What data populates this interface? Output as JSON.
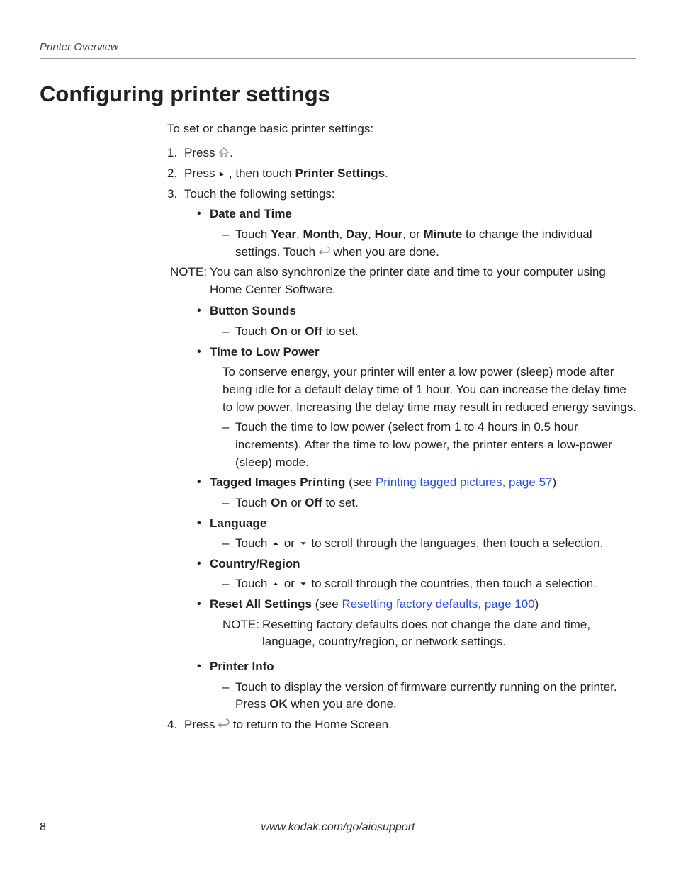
{
  "running_header": "Printer Overview",
  "section_title": "Configuring printer settings",
  "intro": "To set or change basic printer settings:",
  "step1_a": "Press ",
  "step1_b": ".",
  "step2_a": "Press ",
  "step2_b": " , then touch ",
  "step2_bold": "Printer Settings",
  "step2_c": ".",
  "step3": "Touch the following settings:",
  "date_time_label": "Date and Time",
  "date_time_sub_a": "Touch ",
  "date_time_year": "Year",
  "date_time_comma": ", ",
  "date_time_month": "Month",
  "date_time_day": "Day",
  "date_time_hour": "Hour",
  "date_time_or": ", or ",
  "date_time_minute": "Minute",
  "date_time_sub_b": " to change the individual settings. Touch ",
  "date_time_sub_c": " when you are done.",
  "note1_label": "NOTE:",
  "note1_text": "You can also synchronize the printer date and time to your computer using Home Center Software.",
  "button_sounds_label": "Button Sounds",
  "on_off_a": "Touch ",
  "on": "On",
  "or_word": " or ",
  "off": "Off",
  "on_off_b": " to set.",
  "time_low_power_label": "Time to Low Power",
  "time_low_power_para": "To conserve energy, your printer will enter a low power (sleep) mode after being idle for a default delay time of 1 hour. You can increase the delay time to low power. Increasing the delay time may result in reduced energy savings.",
  "time_low_power_sub": "Touch the time to low power (select from 1 to 4 hours in 0.5 hour increments). After the time to low power, the printer enters a low-power (sleep) mode.",
  "tagged_label": "Tagged Images Printing",
  "tagged_see_a": " (see ",
  "tagged_link": "Printing tagged pictures, page 57",
  "tagged_see_b": ")",
  "language_label": "Language",
  "lang_sub_a": "Touch ",
  "lang_sub_b": " or ",
  "lang_sub_c": " to scroll through the languages, then touch a selection.",
  "country_label": "Country/Region",
  "country_sub_c": " to scroll through the countries, then touch a selection.",
  "reset_label": "Reset All Settings",
  "reset_see_a": " (see ",
  "reset_link": "Resetting factory defaults, page 100",
  "reset_see_b": ")",
  "reset_note_label": "NOTE:",
  "reset_note_text": "Resetting factory defaults does not change the date and time, language, country/region, or network settings.",
  "printer_info_label": "Printer Info",
  "printer_info_sub_a": "Touch to display the version of firmware currently running on the printer. Press ",
  "printer_info_ok": "OK",
  "printer_info_sub_b": " when you are done.",
  "step4_a": "Press ",
  "step4_b": " to return to the Home Screen.",
  "page_number": "8",
  "footer_url": "www.kodak.com/go/aiosupport"
}
